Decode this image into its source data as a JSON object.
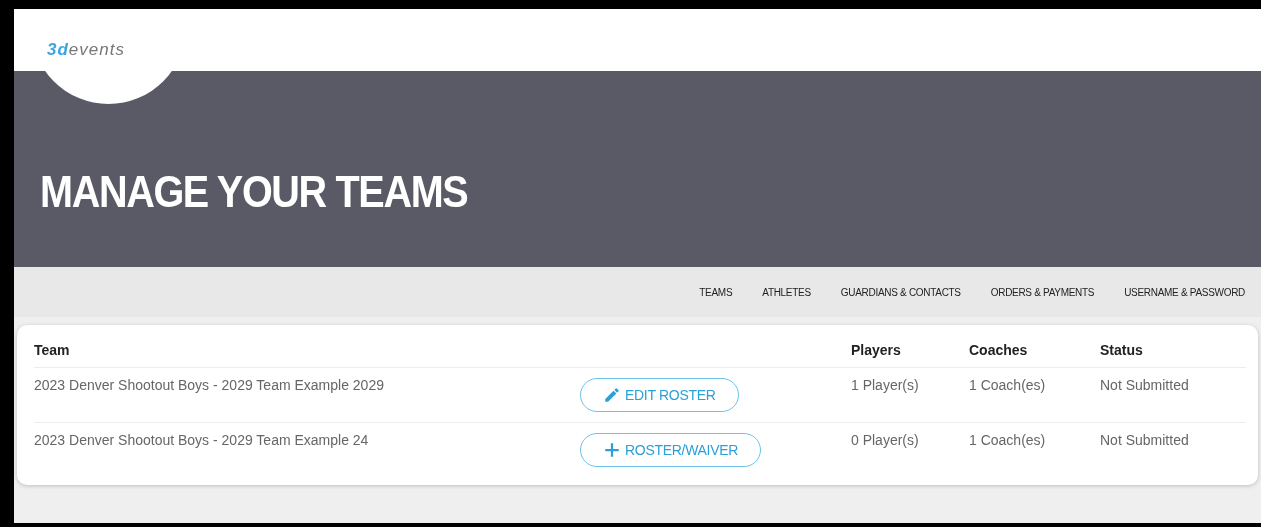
{
  "logo": {
    "prefix": "3d",
    "suffix": "events"
  },
  "title": "MANAGE YOUR TEAMS",
  "nav": [
    {
      "label": "TEAMS"
    },
    {
      "label": "ATHLETES"
    },
    {
      "label": "GUARDIANS & CONTACTS"
    },
    {
      "label": "ORDERS & PAYMENTS"
    },
    {
      "label": "USERNAME & PASSWORD"
    }
  ],
  "table": {
    "columns": [
      "Team",
      "Players",
      "Coaches",
      "Status"
    ],
    "rows": [
      {
        "team": "2023 Denver Shootout Boys - 2029 Team Example 2029",
        "action": {
          "kind": "edit",
          "label": "EDIT ROSTER"
        },
        "players": "1 Player(s)",
        "coaches": "1 Coach(es)",
        "status": "Not Submitted"
      },
      {
        "team": "2023 Denver Shootout Boys - 2029 Team Example 24",
        "action": {
          "kind": "add",
          "label": "ROSTER/WAIVER"
        },
        "players": "0 Player(s)",
        "coaches": "1 Coach(es)",
        "status": "Not Submitted"
      }
    ]
  }
}
